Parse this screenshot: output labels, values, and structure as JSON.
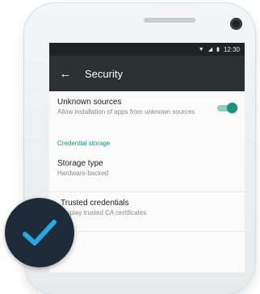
{
  "statusbar": {
    "time": "12:30",
    "icons": [
      "wifi-icon",
      "signal-icon",
      "battery-icon"
    ]
  },
  "appbar": {
    "back_icon": "back-arrow-icon",
    "title": "Security"
  },
  "settings": {
    "unknown_sources": {
      "title": "Unknown sources",
      "subtitle": "Allow installation of apps from unknown sources",
      "enabled": true
    },
    "credential_storage_header": "Credential storage",
    "storage_type": {
      "title": "Storage type",
      "subtitle": "Hardware-backed"
    },
    "trusted_credentials": {
      "title": "Trusted credentials",
      "subtitle": "Display trusted CA certificates"
    }
  },
  "badge": {
    "icon": "checkmark-icon"
  },
  "colors": {
    "accent": "#1e8f78",
    "appbar": "#2b3033",
    "statusbar": "#1f2325",
    "badge": "#1d2b3a",
    "check": "#29a8e0"
  }
}
